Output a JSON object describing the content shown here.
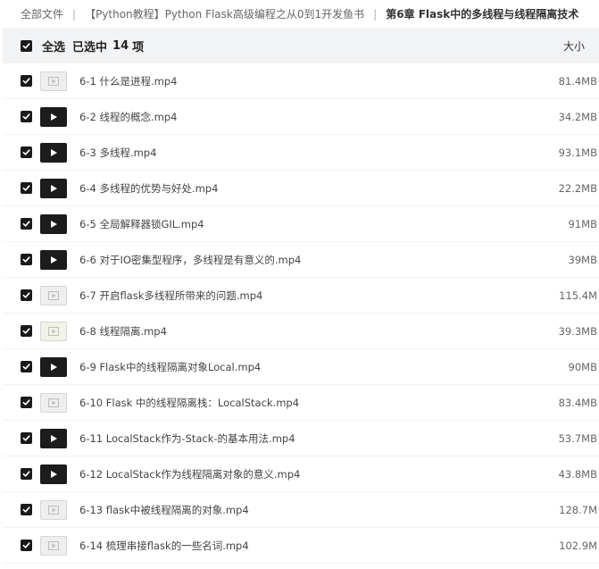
{
  "breadcrumb": {
    "items": [
      "全部文件",
      "【Python教程】Python Flask高级编程之从0到1开发鱼书",
      "第6章 Flask中的多线程与线程隔离技术"
    ],
    "separator": "|"
  },
  "header": {
    "select_all": "全选",
    "selected_label": "已选中",
    "selected_count": "14",
    "selected_unit": "项",
    "size_column": "大小"
  },
  "files": [
    {
      "name": "6-1 什么是进程.mp4",
      "size": "81.4MB",
      "thumb": "light"
    },
    {
      "name": "6-2 线程的概念.mp4",
      "size": "34.2MB",
      "thumb": "dark"
    },
    {
      "name": "6-3 多线程.mp4",
      "size": "93.1MB",
      "thumb": "dark"
    },
    {
      "name": "6-4 多线程的优势与好处.mp4",
      "size": "22.2MB",
      "thumb": "dark"
    },
    {
      "name": "6-5 全局解释器锁GIL.mp4",
      "size": "91MB",
      "thumb": "dark"
    },
    {
      "name": "6-6 对于IO密集型程序，多线程是有意义的.mp4",
      "size": "39MB",
      "thumb": "dark"
    },
    {
      "name": "6-7 开启flask多线程所带来的问题.mp4",
      "size": "115.4M",
      "thumb": "light"
    },
    {
      "name": "6-8 线程隔离.mp4",
      "size": "39.3MB",
      "thumb": "light-tint"
    },
    {
      "name": "6-9 Flask中的线程隔离对象Local.mp4",
      "size": "90MB",
      "thumb": "dark"
    },
    {
      "name": "6-10 Flask 中的线程隔离栈：LocalStack.mp4",
      "size": "83.4MB",
      "thumb": "light"
    },
    {
      "name": "6-11 LocalStack作为-Stack-的基本用法.mp4",
      "size": "53.7MB",
      "thumb": "dark"
    },
    {
      "name": "6-12 LocalStack作为线程隔离对象的意义.mp4",
      "size": "43.8MB",
      "thumb": "dark"
    },
    {
      "name": "6-13 flask中被线程隔离的对象.mp4",
      "size": "128.7M",
      "thumb": "light"
    },
    {
      "name": "6-14 梳理串接flask的一些名词.mp4",
      "size": "102.9M",
      "thumb": "light"
    }
  ]
}
